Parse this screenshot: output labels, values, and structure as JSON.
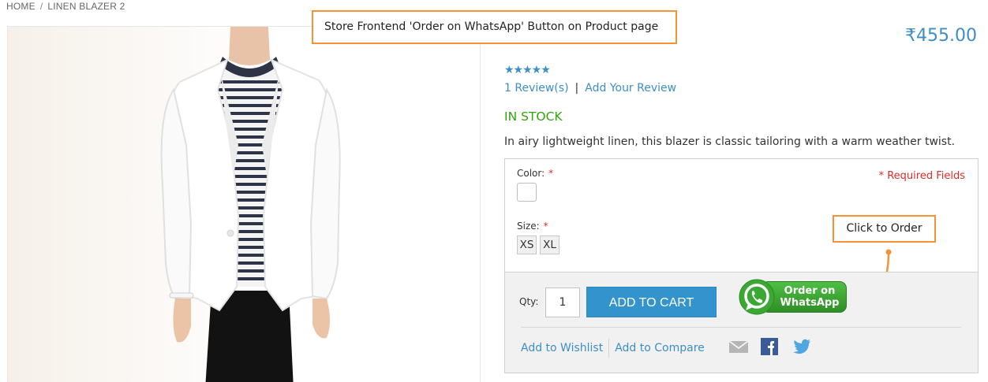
{
  "breadcrumb": {
    "home": "HOME",
    "separator": "/",
    "current": "LINEN BLAZER 2"
  },
  "annotations": {
    "top_callout": "Store Frontend 'Order on WhatsApp' Button on Product page",
    "order_callout": "Click to Order",
    "callout_color": "#f39236"
  },
  "product": {
    "price": "₹455.00",
    "rating_stars": 5,
    "stars_text": "★★★★★",
    "reviews_link": "1 Review(s)",
    "reviews_separator": "|",
    "add_review_link": "Add Your Review",
    "stock_status": "IN STOCK",
    "description": "In airy lightweight linen, this blazer is classic tailoring with a warm weather twist.",
    "image_icon": "product-photo"
  },
  "options": {
    "color_label": "Color:",
    "size_label": "Size:",
    "required_mark": "*",
    "required_note": "* Required Fields",
    "sizes": [
      "XS",
      "XL"
    ]
  },
  "cart": {
    "qty_label": "Qty:",
    "qty_value": "1",
    "add_to_cart": "ADD TO CART",
    "whatsapp_line1": "Order on",
    "whatsapp_line2": "WhatsApp",
    "wishlist": "Add to Wishlist",
    "compare": "Add to Compare",
    "share_icons": [
      "email-icon",
      "facebook-icon",
      "twitter-icon"
    ]
  },
  "colors": {
    "accent": "#3e8ec6",
    "in_stock": "#32a30a",
    "required": "#e02b27",
    "cart_button": "#3393cd",
    "whatsapp": "#3a9d2f"
  }
}
